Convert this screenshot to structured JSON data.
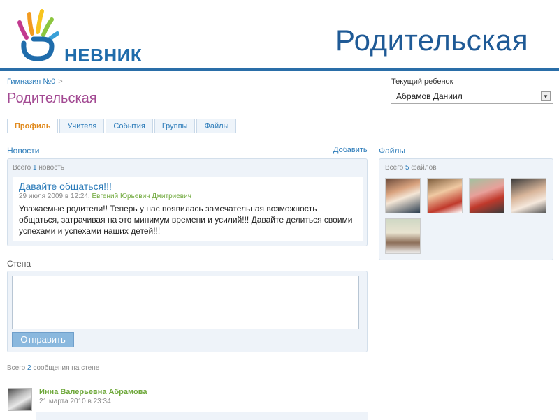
{
  "slide": {
    "title": "Родительская"
  },
  "logo": {
    "text": "НЕВНИК"
  },
  "breadcrumb": {
    "school": "Гимназия №0",
    "separator": ">"
  },
  "page": {
    "title": "Родительская"
  },
  "child_selector": {
    "label": "Текущий ребенок",
    "value": "Абрамов Даниил"
  },
  "tabs": [
    {
      "label": "Профиль",
      "active": true
    },
    {
      "label": "Учителя"
    },
    {
      "label": "События"
    },
    {
      "label": "Группы"
    },
    {
      "label": "Файлы"
    }
  ],
  "news": {
    "heading": "Новости",
    "add_label": "Добавить",
    "count_prefix": "Всего",
    "count": "1",
    "count_suffix": "новость",
    "item": {
      "title": "Давайте общаться!!!",
      "date": "29 июля 2009 в 12:24,",
      "author": "Евгений Юрьевич Дмитриевич",
      "body": "Уважаемые родители!! Теперь у нас появилась замечательная возможность общаться, затрачивая на это минимум времени и усилий!!! Давайте делиться своими успехами и успехами наших детей!!!"
    }
  },
  "files": {
    "heading": "Файлы",
    "count_prefix": "Всего",
    "count": "5",
    "count_suffix": "файлов",
    "photos": [
      {
        "name": "photo-1"
      },
      {
        "name": "photo-2"
      },
      {
        "name": "photo-3"
      },
      {
        "name": "photo-4"
      },
      {
        "name": "photo-5"
      }
    ]
  },
  "wall": {
    "heading": "Стена",
    "send_label": "Отправить",
    "count_prefix": "Всего",
    "count": "2",
    "count_suffix": "сообщения на стене"
  },
  "message": {
    "author": "Инна Валерьевна Абрамова",
    "date": "21 марта 2010 в 23:34"
  },
  "colors": {
    "accent": "#2b7bb9",
    "title": "#a34a93",
    "active_tab": "#e08a1e",
    "author": "#6ea83a",
    "panel": "#eef3f9"
  }
}
